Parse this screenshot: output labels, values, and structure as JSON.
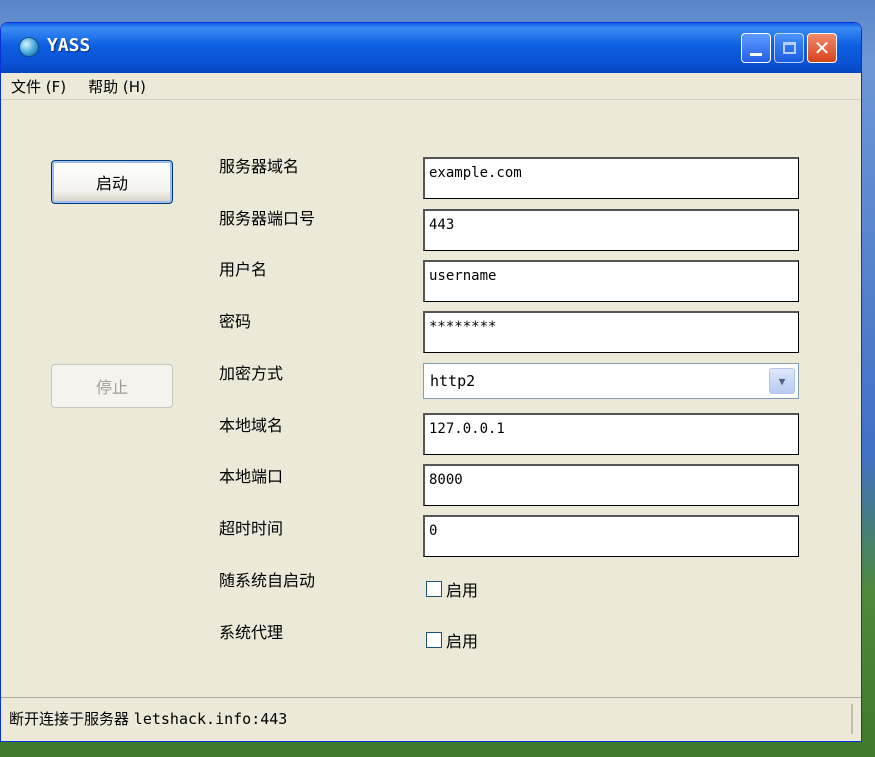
{
  "window": {
    "title": "YASS"
  },
  "menu": {
    "file": "文件 (F)",
    "help": "帮助 (H)"
  },
  "buttons": {
    "start": "启动",
    "stop": "停止"
  },
  "labels": {
    "server_domain": "服务器域名",
    "server_port": "服务器端口号",
    "username": "用户名",
    "password": "密码",
    "method": "加密方式",
    "local_domain": "本地域名",
    "local_port": "本地端口",
    "timeout": "超时时间",
    "autostart": "随系统自启动",
    "system_proxy": "系统代理"
  },
  "values": {
    "server_domain": "example.com",
    "server_port": "443",
    "username": "username",
    "password": "********",
    "method": "http2",
    "local_domain": "127.0.0.1",
    "local_port": "8000",
    "timeout": "0"
  },
  "checkboxes": {
    "autostart": "启用",
    "system_proxy": "启用"
  },
  "status": {
    "prefix": "断开连接于服务器",
    "server": "letshack.info:443"
  },
  "icons": {
    "app": "app-globe-icon",
    "minimize": "minimize-icon",
    "maximize": "maximize-icon",
    "close": "close-icon",
    "dropdown": "chevron-down-icon"
  }
}
